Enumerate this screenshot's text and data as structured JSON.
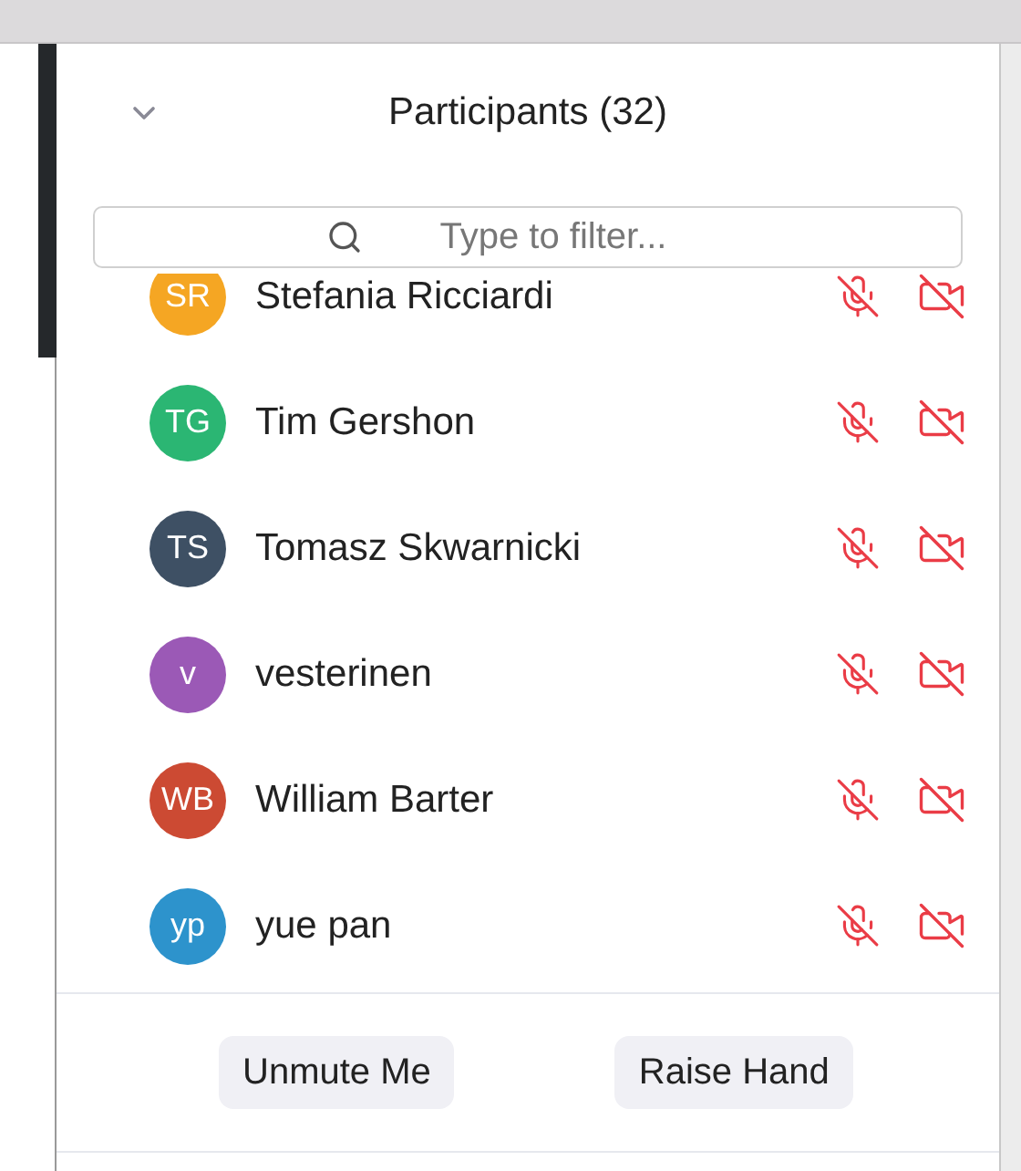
{
  "panel": {
    "title": "Participants (32)",
    "search": {
      "placeholder": "Type to filter..."
    },
    "participants": [
      {
        "initials": "SR",
        "name": "Stefania Ricciardi",
        "color": "#f5a623",
        "audio_muted": true,
        "video_off": true
      },
      {
        "initials": "TG",
        "name": "Tim Gershon",
        "color": "#2bb673",
        "audio_muted": true,
        "video_off": true
      },
      {
        "initials": "TS",
        "name": "Tomasz Skwarnicki",
        "color": "#3e5064",
        "audio_muted": true,
        "video_off": true
      },
      {
        "initials": "v",
        "name": "vesterinen",
        "color": "#9b59b6",
        "audio_muted": true,
        "video_off": true
      },
      {
        "initials": "WB",
        "name": "William Barter",
        "color": "#cc4a33",
        "audio_muted": true,
        "video_off": true
      },
      {
        "initials": "yp",
        "name": "yue pan",
        "color": "#2d93cc",
        "audio_muted": true,
        "video_off": true
      }
    ],
    "buttons": [
      "Unmute Me",
      "Raise Hand"
    ]
  }
}
